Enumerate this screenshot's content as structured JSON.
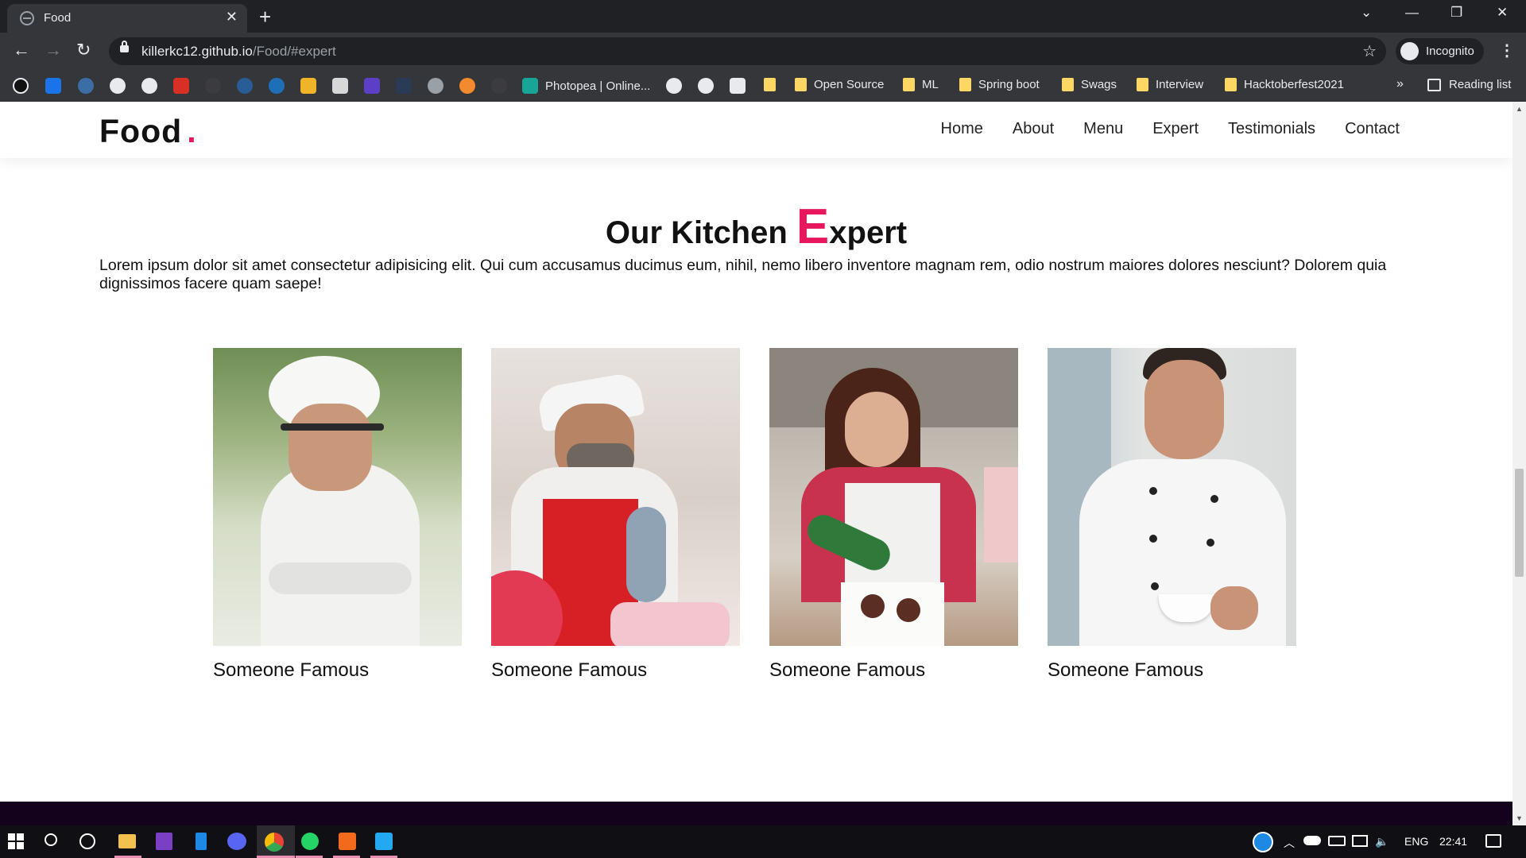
{
  "browser": {
    "tab_title": "Food",
    "url_host": "killerkc12.github.io",
    "url_path": "/Food/#expert",
    "profile_label": "Incognito",
    "bookmarks": [
      {
        "label": "Photopea | Online..."
      },
      {
        "label": "Open Source"
      },
      {
        "label": "ML"
      },
      {
        "label": "Spring boot"
      },
      {
        "label": "Swags"
      },
      {
        "label": "Interview"
      },
      {
        "label": "Hacktoberfest2021"
      }
    ],
    "bookmarks_more": "»",
    "reading_list": "Reading list"
  },
  "site": {
    "logo": "Food",
    "logo_dot": ".",
    "nav": [
      "Home",
      "About",
      "Menu",
      "Expert",
      "Testimonials",
      "Contact"
    ],
    "section_title_pre": "Our Kitchen ",
    "section_title_big": "E",
    "section_title_post": "xpert",
    "intro": "Lorem ipsum dolor sit amet consectetur adipisicing elit. Qui cum accusamus ducimus eum, nihil, nemo libero inventore magnam rem, odio nostrum maiores dolores nesciunt? Dolorem quia dignissimos facere quam saepe!",
    "experts": [
      {
        "name": "Someone Famous"
      },
      {
        "name": "Someone Famous"
      },
      {
        "name": "Someone Famous"
      },
      {
        "name": "Someone Famous"
      }
    ],
    "accent_color": "#e8175d"
  },
  "taskbar": {
    "language": "ENG",
    "time": "22:41"
  }
}
